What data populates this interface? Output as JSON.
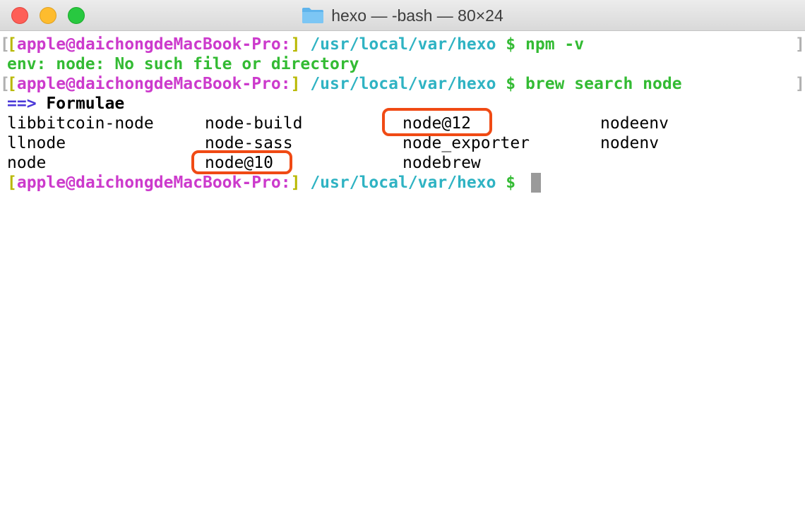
{
  "window": {
    "title": "hexo — -bash — 80×24",
    "folder_icon": "folder-icon"
  },
  "prompt": {
    "open_bracket": "[",
    "user": "apple",
    "at": "@",
    "host": "daichongdeMacBook-Pro:",
    "close_bracket": "]",
    "path": "/usr/local/var/hexo",
    "dollar": "$"
  },
  "lines": {
    "cmd1": "npm -v",
    "error": "env: node: No such file or directory",
    "cmd2": "brew search node",
    "arrow": "==>",
    "heading": "Formulae"
  },
  "formulae": {
    "row1": [
      "libbitcoin-node",
      "node-build",
      "node@12",
      "nodeenv"
    ],
    "row2": [
      "llnode",
      "node-sass",
      "node_exporter",
      "nodenv"
    ],
    "row3": [
      "node",
      "node@10",
      "nodebrew"
    ]
  },
  "highlighted": [
    "node@12",
    "node@10"
  ],
  "colors": {
    "prompt_user": "#cc3acc",
    "prompt_path": "#2fb3c3",
    "command": "#33bb33",
    "bracket": "#b8b800",
    "arrow": "#4a38d8",
    "highlight_box": "#f04a14"
  }
}
